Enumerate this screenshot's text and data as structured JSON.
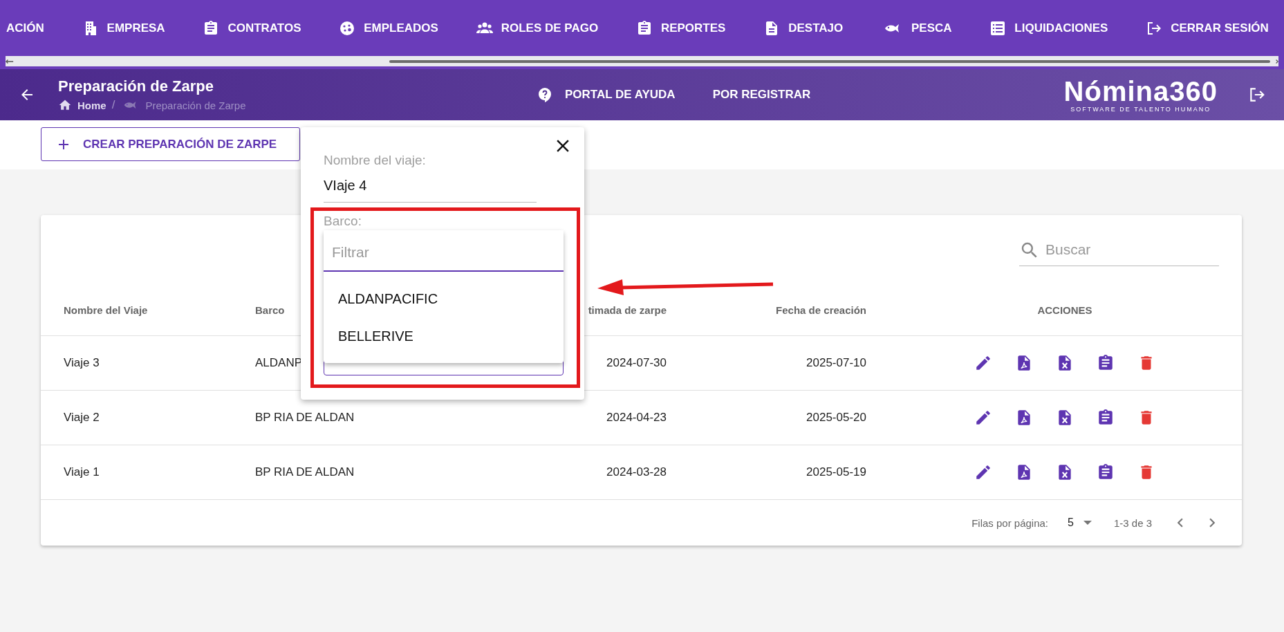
{
  "top_nav": {
    "items": [
      {
        "label": "ACIÓN"
      },
      {
        "label": "EMPRESA"
      },
      {
        "label": "CONTRATOS"
      },
      {
        "label": "EMPLEADOS"
      },
      {
        "label": "ROLES DE PAGO"
      },
      {
        "label": "REPORTES"
      },
      {
        "label": "DESTAJO"
      },
      {
        "label": "PESCA"
      },
      {
        "label": "LIQUIDACIONES"
      },
      {
        "label": "CERRAR SESIÓN"
      }
    ]
  },
  "header": {
    "title": "Preparación de Zarpe",
    "breadcrumb_separator": "/",
    "breadcrumb": [
      {
        "label": "Home",
        "current": false
      },
      {
        "label": "Preparación de Zarpe",
        "current": true
      }
    ],
    "links": [
      {
        "label": "PORTAL DE AYUDA"
      },
      {
        "label": "POR REGISTRAR"
      }
    ],
    "logo": {
      "name": "Nómina360",
      "tagline": "SOFTWARE DE TALENTO HUMANO"
    }
  },
  "toolbar": {
    "create_button": "CREAR PREPARACIÓN DE ZARPE"
  },
  "table": {
    "search": {
      "placeholder": "Buscar"
    },
    "columns": [
      "Nombre del Viaje",
      "Barco",
      "timada de zarpe",
      "Fecha de creación",
      "ACCIONES"
    ],
    "rows": [
      {
        "cells": [
          "Viaje 3",
          "ALDANP",
          "2024-07-30",
          "2025-07-10"
        ]
      },
      {
        "cells": [
          "Viaje 2",
          "BP RIA DE ALDAN",
          "2024-04-23",
          "2025-05-20"
        ]
      },
      {
        "cells": [
          "Viaje 1",
          "BP RIA DE ALDAN",
          "2024-03-28",
          "2025-05-19"
        ]
      }
    ],
    "footer": {
      "rows_per_page_label": "Filas por página:",
      "rows_per_page": "5",
      "range": "1-3 de 3"
    }
  },
  "dialog": {
    "fields": [
      {
        "label": "Nombre del viaje:",
        "value": "VIaje 4"
      },
      {
        "label": "Barco:"
      }
    ],
    "dropdown": {
      "filter_placeholder": "Filtrar",
      "options": [
        "ALDANPACIFIC",
        "BELLERIVE"
      ]
    }
  },
  "annotations": {
    "frame": true,
    "arrow": true
  }
}
